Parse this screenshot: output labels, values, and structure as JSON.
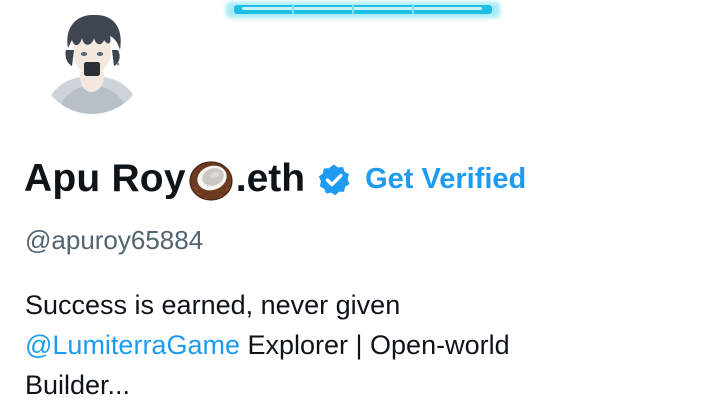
{
  "profile": {
    "display_name": "Apu Roy",
    "display_name_emoji": "coconut-icon",
    "display_name_suffix": ".eth",
    "verified_badge_icon": "verified-badge-icon",
    "get_verified_label": "Get Verified",
    "handle": "@apuroy65884",
    "bio": {
      "line1": "Success is earned, never given",
      "mention": "@LumiterraGame",
      "line2_rest": " Explorer |  Open-world",
      "line3": "Builder..."
    }
  },
  "colors": {
    "accent": "#1d9bf0",
    "text_primary": "#0f1419",
    "text_secondary": "#536471",
    "banner_cyan": "#20c4e6"
  }
}
